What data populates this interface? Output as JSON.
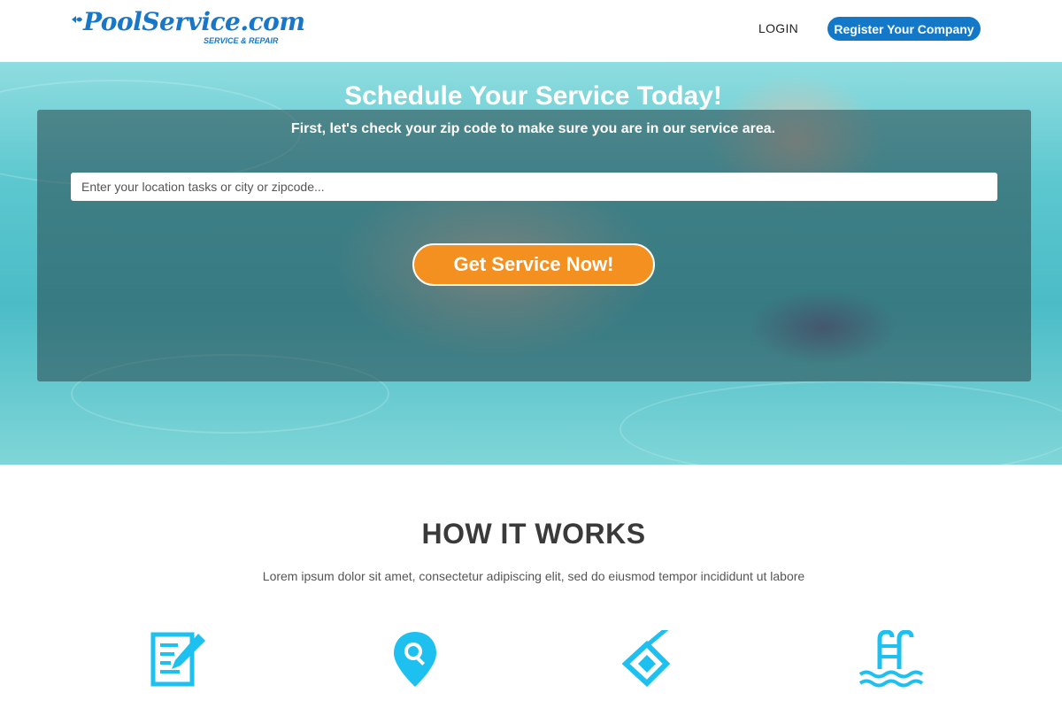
{
  "header": {
    "logo_text": "PoolService.com",
    "logo_tagline": "SERVICE & REPAIR",
    "login_label": "LOGIN",
    "register_label": "Register Your Company"
  },
  "hero": {
    "title": "Schedule Your Service Today!",
    "subtitle": "First, let's check your zip code to make sure you are in our service area.",
    "search_placeholder": "Enter your location tasks or city or zipcode...",
    "search_value": "",
    "cta_label": "Get Service Now!"
  },
  "how_it_works": {
    "title": "HOW IT WORKS",
    "description": "Lorem ipsum dolor sit amet, consectetur adipiscing elit, sed do eiusmod tempor incididunt ut labore",
    "steps": [
      {
        "icon": "form-edit-icon"
      },
      {
        "icon": "location-search-icon"
      },
      {
        "icon": "pool-skimmer-icon"
      },
      {
        "icon": "pool-ladder-icon"
      }
    ]
  },
  "colors": {
    "brand_blue": "#1478c9",
    "cta_orange": "#f39020",
    "icon_cyan": "#1ec0f0",
    "heading_gray": "#3a3a3a"
  }
}
